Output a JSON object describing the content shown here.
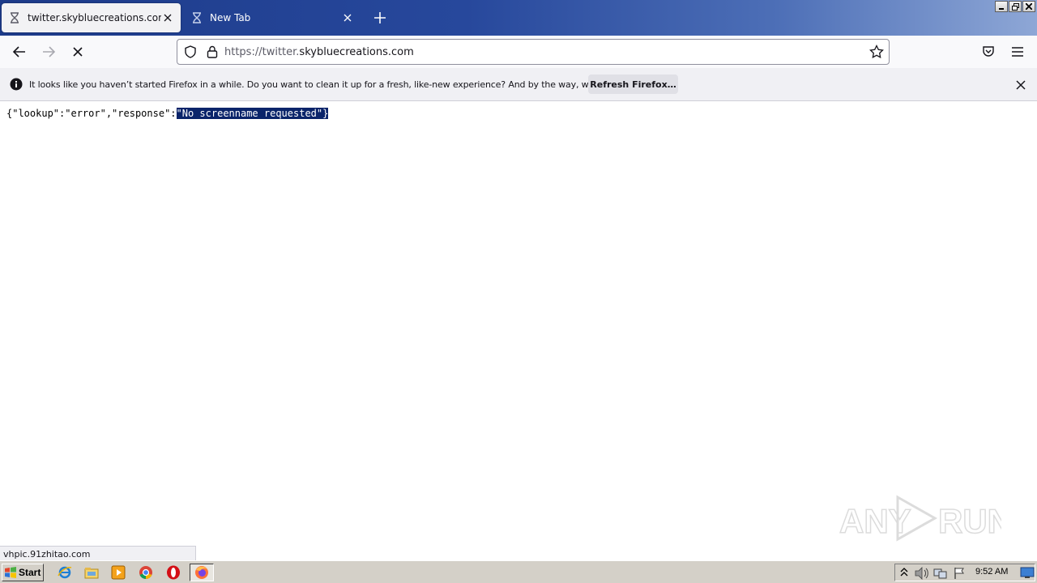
{
  "tabs": [
    {
      "title": "twitter.skybluecreations.com/",
      "active": true
    },
    {
      "title": "New Tab",
      "active": false
    }
  ],
  "window_controls": [
    "minimize",
    "restore",
    "close"
  ],
  "toolbar": {
    "url_prefix": "https://twitter.",
    "url_domain": "skybluecreations.com"
  },
  "notification": {
    "message": "It looks like you haven’t started Firefox in a while. Do you want to clean it up for a fresh, like-new experience? And by the way, welcome back!",
    "button_label": "Refresh Firefox…"
  },
  "page": {
    "json_prefix": "{\"lookup\":\"error\",\"response\":",
    "json_selected": "\"No screenname requested\"}"
  },
  "status_bar": {
    "url": "vhpic.91zhitao.com"
  },
  "watermark": {
    "text_left": "ANY",
    "text_right": "RUN"
  },
  "taskbar": {
    "start_label": "Start",
    "clock": "9:52 AM",
    "pinned": [
      "ie-icon",
      "explorer-icon",
      "media-player-icon",
      "chrome-icon",
      "opera-icon",
      "firefox-icon"
    ]
  },
  "colors": {
    "selection": "#0a246a",
    "titlebar": "#27489c",
    "taskbar": "#d4d0c8"
  }
}
